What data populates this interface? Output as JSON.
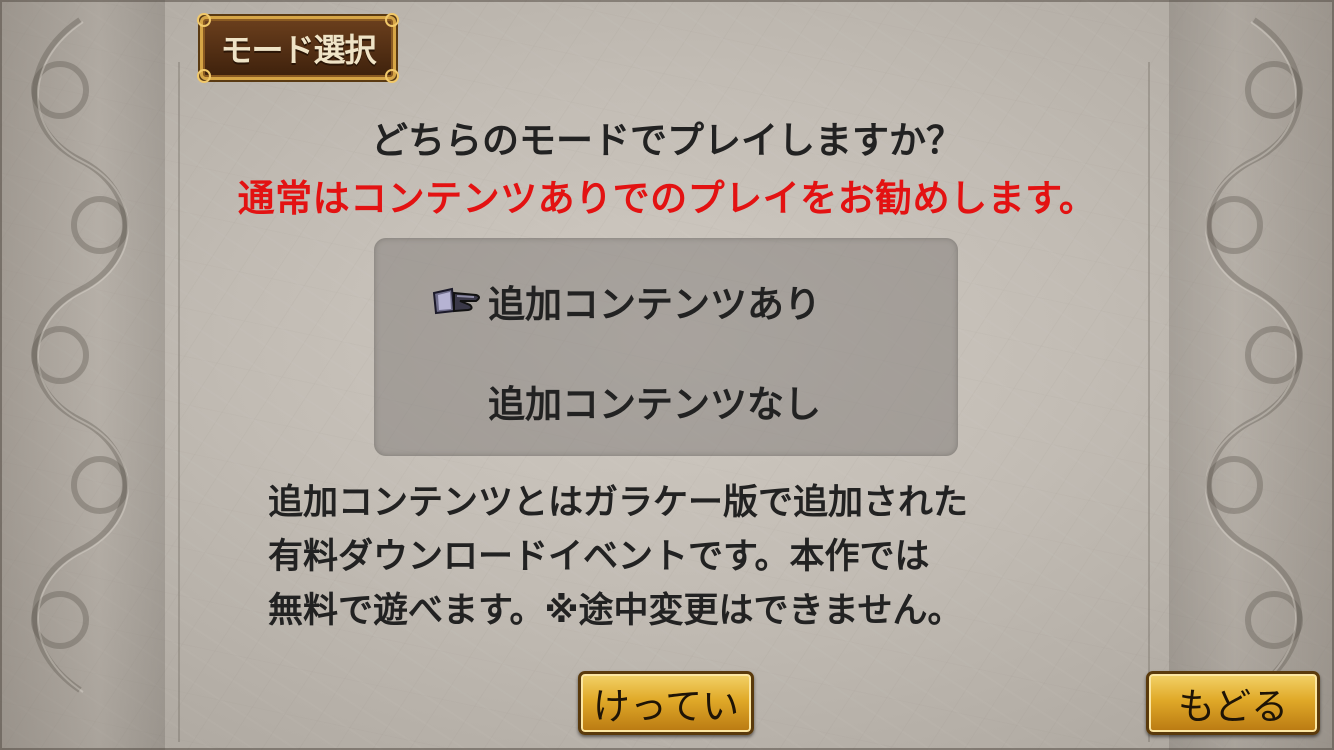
{
  "title": "モード選択",
  "question": "どちらのモードでプレイしますか？",
  "recommendation": "通常はコンテンツありでのプレイをお勧めします。",
  "colors": {
    "recommendation": "#e31212",
    "button": "#e0a928",
    "title_badge": "#4e2c12"
  },
  "options": [
    {
      "label": "追加コンテンツあり",
      "selected": true,
      "cursor_icon": "gauntlet-pointer-icon"
    },
    {
      "label": "追加コンテンツなし",
      "selected": false
    }
  ],
  "note_lines": [
    "追加コンテンツとはガラケー版で追加された",
    "有料ダウンロードイベントです。本作では",
    "無料で遊べます。※途中変更はできません。"
  ],
  "buttons": {
    "confirm": "けってい",
    "back": "もどる"
  }
}
